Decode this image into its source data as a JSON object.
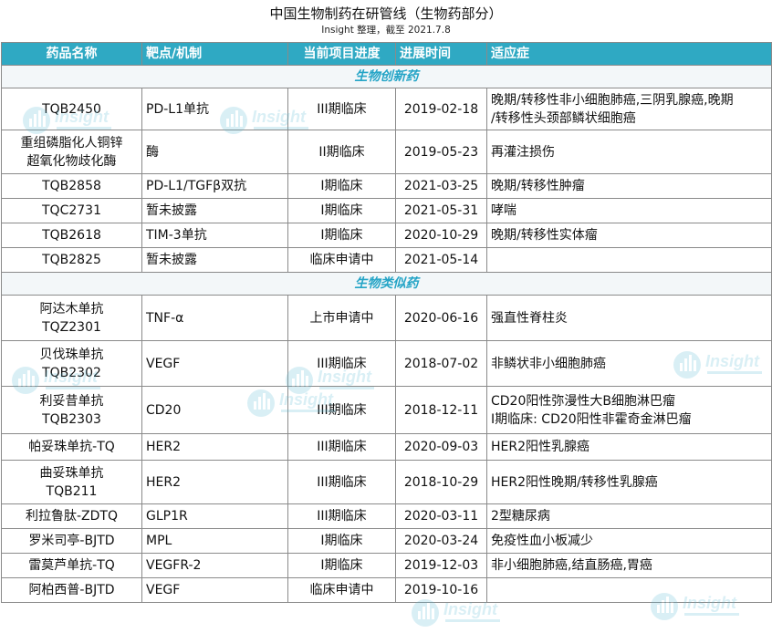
{
  "title": "中国生物制药在研管线（生物药部分）",
  "subtitle": "Insight 整理，截至 2021.7.8",
  "headers": [
    "药品名称",
    "靶点/机制",
    "当前项目进度",
    "进展时间",
    "适应症"
  ],
  "sections": [
    {
      "label": "生物创新药",
      "rows": [
        {
          "name": [
            "TQB2450"
          ],
          "target": "PD-L1单抗",
          "stage": "III期临床",
          "date": "2019-02-18",
          "indication": [
            "晚期/转移性非小细胞肺癌,三阴乳腺癌,晚期",
            "/转移性头颈部鳞状细胞癌"
          ]
        },
        {
          "name": [
            "重组磷脂化人铜锌",
            "超氧化物歧化酶"
          ],
          "target": "酶",
          "stage": "II期临床",
          "date": "2019-05-23",
          "indication": [
            "再灌注损伤"
          ]
        },
        {
          "name": [
            "TQB2858"
          ],
          "target": "PD-L1/TGFβ双抗",
          "stage": "I期临床",
          "date": "2021-03-25",
          "indication": [
            "晚期/转移性肿瘤"
          ]
        },
        {
          "name": [
            "TQC2731"
          ],
          "target": "暂未披露",
          "stage": "I期临床",
          "date": "2021-05-31",
          "indication": [
            "哮喘"
          ]
        },
        {
          "name": [
            "TQB2618"
          ],
          "target": "TIM-3单抗",
          "stage": "I期临床",
          "date": "2020-10-29",
          "indication": [
            "晚期/转移性实体瘤"
          ]
        },
        {
          "name": [
            "TQB2825"
          ],
          "target": "暂未披露",
          "stage": "临床申请中",
          "date": "2021-05-14",
          "indication": [
            ""
          ]
        }
      ]
    },
    {
      "label": "生物类似药",
      "rows": [
        {
          "name": [
            "阿达木单抗",
            "TQZ2301"
          ],
          "target": "TNF-α",
          "stage": "上市申请中",
          "date": "2020-06-16",
          "indication": [
            "强直性脊柱炎"
          ]
        },
        {
          "name": [
            "贝伐珠单抗",
            "TQB2302"
          ],
          "target": "VEGF",
          "stage": "III期临床",
          "date": "2018-07-02",
          "indication": [
            "非鳞状非小细胞肺癌"
          ]
        },
        {
          "name": [
            "利妥昔单抗",
            "TQB2303"
          ],
          "target": "CD20",
          "stage": "III期临床",
          "date": "2018-12-11",
          "indication": [
            "CD20阳性弥漫性大B细胞淋巴瘤",
            "I期临床: CD20阳性非霍奇金淋巴瘤"
          ]
        },
        {
          "name": [
            "帕妥珠单抗-TQ"
          ],
          "target": "HER2",
          "stage": "III期临床",
          "date": "2020-09-03",
          "indication": [
            "HER2阳性乳腺癌"
          ]
        },
        {
          "name": [
            "曲妥珠单抗",
            "TQB211"
          ],
          "target": "HER2",
          "stage": "III期临床",
          "date": "2018-10-29",
          "indication": [
            "HER2阳性晚期/转移性乳腺癌"
          ]
        },
        {
          "name": [
            "利拉鲁肽-ZDTQ"
          ],
          "target": "GLP1R",
          "stage": "III期临床",
          "date": "2020-03-11",
          "indication": [
            "2型糖尿病"
          ]
        },
        {
          "name": [
            "罗米司亭-BJTD"
          ],
          "target": "MPL",
          "stage": "I期临床",
          "date": "2020-03-24",
          "indication": [
            "免疫性血小板减少"
          ]
        },
        {
          "name": [
            "雷莫芦单抗-TQ"
          ],
          "target": "VEGFR-2",
          "stage": "I期临床",
          "date": "2019-12-03",
          "indication": [
            "非小细胞肺癌,结直肠癌,胃癌"
          ]
        },
        {
          "name": [
            "阿柏西普-BJTD"
          ],
          "target": "VEGF",
          "stage": "临床申请中",
          "date": "2019-10-16",
          "indication": [
            ""
          ]
        }
      ]
    }
  ],
  "watermark": {
    "icon": "insight-logo-icon",
    "text": "Insight"
  },
  "colors": {
    "header_bg": "#2fa9c3",
    "header_text": "#ffffff",
    "section_text": "#24a4c6",
    "border": "#8a8a8a"
  }
}
